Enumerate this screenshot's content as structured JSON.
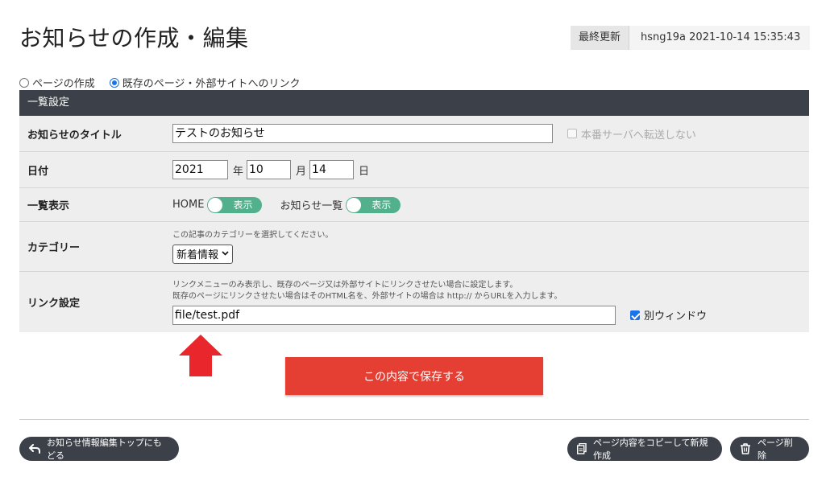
{
  "header": {
    "title": "お知らせの作成・編集",
    "last_updated_label": "最終更新",
    "last_updated_value": "hsng19a 2021-10-14 15:35:43"
  },
  "page_type": {
    "options": [
      "ページの作成",
      "既存のページ・外部サイトへのリンク"
    ],
    "selected": "既存のページ・外部サイトへのリンク"
  },
  "form": {
    "section_title": "一覧設定",
    "title_row": {
      "label": "お知らせのタイトル",
      "value": "テストのお知らせ",
      "no_transfer_label": "本番サーバへ転送しない"
    },
    "date_row": {
      "label": "日付",
      "year": "2021",
      "year_unit": "年",
      "month": "10",
      "month_unit": "月",
      "day": "14",
      "day_unit": "日"
    },
    "display_row": {
      "label": "一覧表示",
      "home_label": "HOME",
      "home_toggle": "表示",
      "news_label": "お知らせ一覧",
      "news_toggle": "表示"
    },
    "category_row": {
      "label": "カテゴリー",
      "hint": "この記事のカテゴリーを選択してください。",
      "selected": "新着情報"
    },
    "link_row": {
      "label": "リンク設定",
      "hint1": "リンクメニューのみ表示し、既存のページ又は外部サイトにリンクさせたい場合に設定します。",
      "hint2": "既存のページにリンクさせたい場合はそのHTML名を、外部サイトの場合は http:// からURLを入力します。",
      "value": "file/test.pdf",
      "new_window_label": "別ウィンドウ"
    }
  },
  "save_button": "この内容で保存する",
  "footer": {
    "back_button": "お知らせ情報編集トップにもどる",
    "copy_button": "ページ内容をコピーして新規作成",
    "delete_button": "ページ削除"
  },
  "colors": {
    "header_bar": "#3c4149",
    "row_bg": "#eeeeee",
    "toggle_on": "#52b18c",
    "save_button": "#e53f34",
    "arrow": "#e8262b",
    "radio_checked": "#1a73e8"
  },
  "icons": {
    "back": "back-arrow-icon",
    "copy": "copy-icon",
    "delete": "trash-icon",
    "annotation": "red-up-arrow-icon"
  }
}
